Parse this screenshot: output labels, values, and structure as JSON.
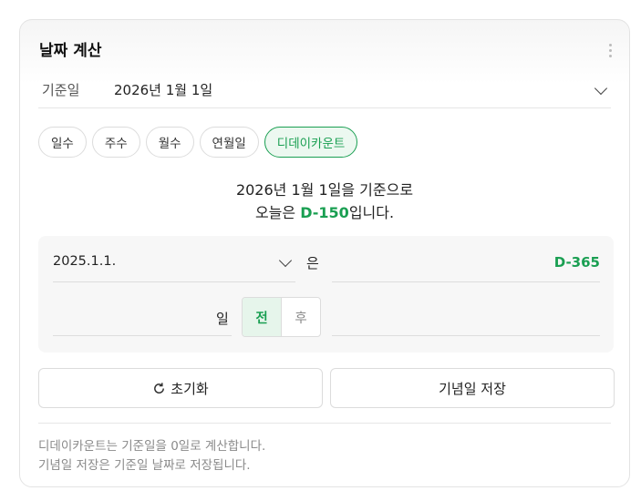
{
  "title": "날짜 계산",
  "base_date": {
    "label": "기준일",
    "value": "2026년 1월 1일"
  },
  "tabs": [
    {
      "label": "일수"
    },
    {
      "label": "주수"
    },
    {
      "label": "월수"
    },
    {
      "label": "연월일"
    },
    {
      "label": "디데이카운트",
      "active": true
    }
  ],
  "result": {
    "line1": "2026년 1월 1일을 기준으로",
    "prefix": "오늘은 ",
    "dday": "D-150",
    "suffix": "입니다."
  },
  "calc": {
    "date_value": "2025.1.1.",
    "connector": "은",
    "dday_output": "D-365",
    "day_unit": "일",
    "before_label": "전",
    "after_label": "후",
    "selected": "before"
  },
  "buttons": {
    "reset_label": "초기화",
    "save_label": "기념일 저장"
  },
  "notes": [
    "디데이카운트는 기준일을 0일로 계산합니다.",
    "기념일 저장은 기준일 날짜로 저장됩니다."
  ],
  "colors": {
    "accent": "#1a9f52",
    "accent_bg": "#ecf8f0"
  }
}
